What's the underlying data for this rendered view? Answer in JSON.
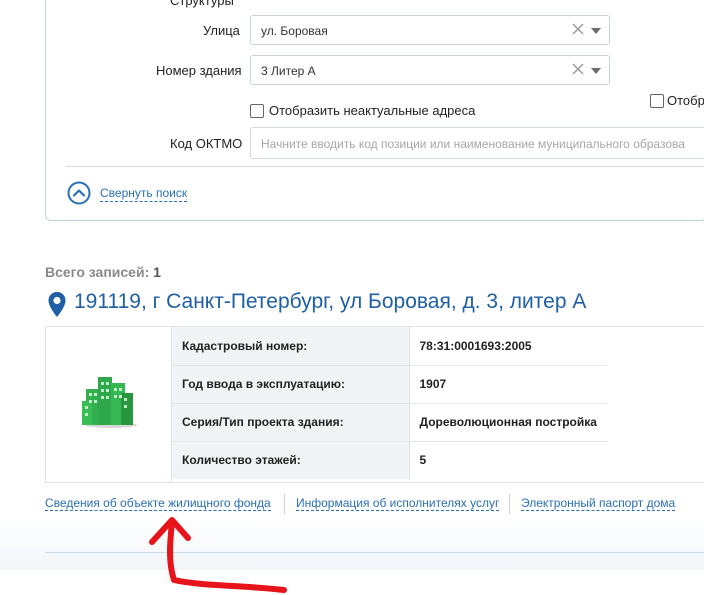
{
  "search": {
    "cut_label": "Структуры",
    "street": {
      "label": "Улица",
      "value": "ул. Боровая"
    },
    "building": {
      "label": "Номер здания",
      "value": "3 Литер А"
    },
    "show_inactive_label": "Отобразить неактуальные адреса",
    "cut_checkbox_label": "Отобра",
    "oktmo": {
      "label": "Код ОКТМО",
      "placeholder": "Начните вводить код позиции или наименование муниципального образова"
    },
    "collapse_label": "Свернуть поиск"
  },
  "results": {
    "total_label": "Всего записей:",
    "total_value": "1",
    "address": "191119, г Санкт-Петербург, ул Боровая, д. 3, литер А",
    "rows": [
      {
        "key": "Кадастровый номер:",
        "value": "78:31:0001693:2005"
      },
      {
        "key": "Год ввода в эксплуатацию:",
        "value": "1907"
      },
      {
        "key": "Серия/Тип проекта здания:",
        "value": "Дореволюционная постройка"
      },
      {
        "key": "Количество этажей:",
        "value": "5"
      }
    ],
    "links": {
      "housing_fund": "Сведения об объекте жилищного фонда",
      "service_providers": "Информация об исполнителях услуг",
      "passport": "Электронный паспорт дома"
    }
  },
  "colors": {
    "accent": "#2a6fb5",
    "title": "#1f5fa6",
    "annotation": "#e8141b",
    "building": "#2ea84a"
  }
}
